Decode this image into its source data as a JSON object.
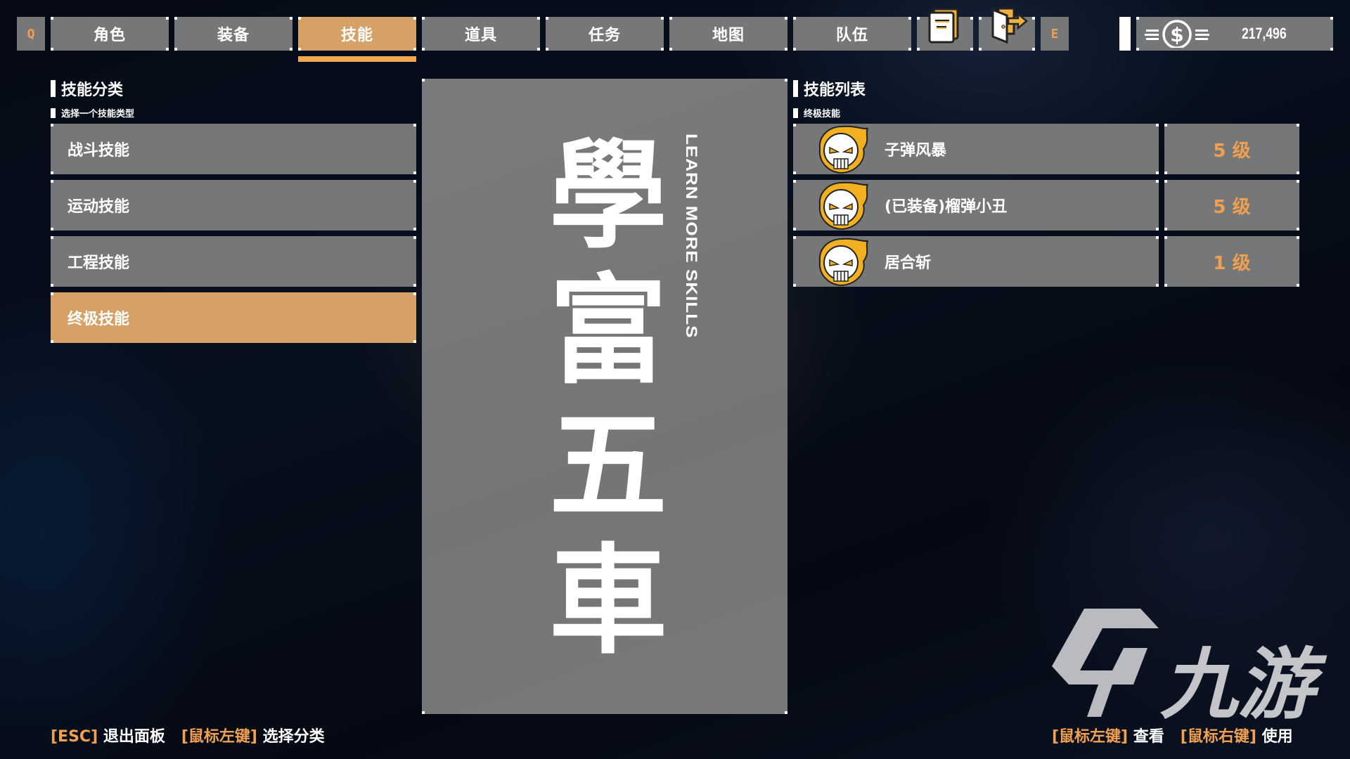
{
  "tabs": {
    "prev_key": "Q",
    "next_key": "E",
    "items": [
      {
        "label": "角色",
        "active": false
      },
      {
        "label": "装备",
        "active": false
      },
      {
        "label": "技能",
        "active": true
      },
      {
        "label": "道具",
        "active": false
      },
      {
        "label": "任务",
        "active": false
      },
      {
        "label": "地图",
        "active": false
      },
      {
        "label": "队伍",
        "active": false
      }
    ],
    "icon_buttons": [
      "journal-icon",
      "exit-door-icon"
    ]
  },
  "currency": {
    "icon": "dollar-coin-icon",
    "value": "217,496"
  },
  "categories": {
    "title": "技能分类",
    "subtitle": "选择一个技能类型",
    "items": [
      {
        "label": "战斗技能",
        "selected": false
      },
      {
        "label": "运动技能",
        "selected": false
      },
      {
        "label": "工程技能",
        "selected": false
      },
      {
        "label": "终极技能",
        "selected": true
      }
    ]
  },
  "banner": {
    "chars": [
      "學",
      "富",
      "五",
      "車"
    ],
    "subtitle": "LEARN MORE SKILLS"
  },
  "skills": {
    "title": "技能列表",
    "subtitle": "终极技能",
    "items": [
      {
        "icon": "flaming-skull-icon",
        "name": "子弹风暴",
        "level": "5 级"
      },
      {
        "icon": "flaming-skull-icon",
        "name": "(已装备)榴弹小丑",
        "level": "5 级"
      },
      {
        "icon": "flaming-skull-icon",
        "name": "居合斩",
        "level": "1 级"
      }
    ]
  },
  "hints_left": [
    {
      "key": "[ESC]",
      "action": "退出面板"
    },
    {
      "key": "[鼠标左键]",
      "action": "选择分类"
    }
  ],
  "hints_right": [
    {
      "key": "[鼠标左键]",
      "action": "查看"
    },
    {
      "key": "[鼠标右键]",
      "action": "使用"
    }
  ],
  "watermark": {
    "text": "九游"
  },
  "colors": {
    "accent": "#d5a166",
    "accent_bright": "#f0a850",
    "panel": "#767778",
    "key_text": "#f0a050"
  }
}
